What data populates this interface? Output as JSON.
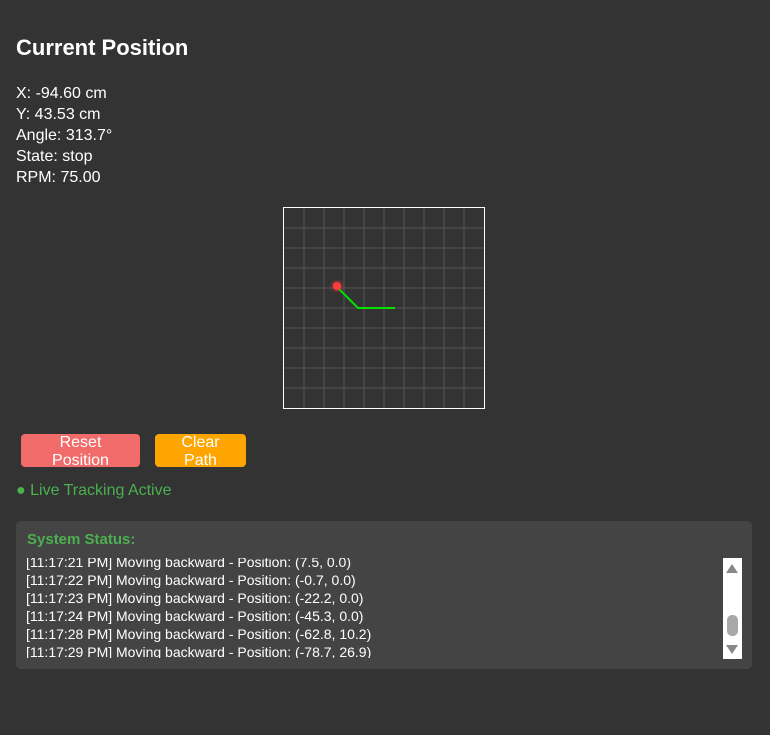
{
  "header": {
    "title": "Current Position"
  },
  "position": {
    "x_text": "X: -94.60 cm",
    "y_text": "Y: 43.53 cm",
    "angle_text": "Angle: 313.7°",
    "state_text": "State: stop",
    "rpm_text": "RPM: 75.00"
  },
  "colors": {
    "path": "#00e000",
    "robot": "#ff3b3b",
    "reset_button": "#f26b6b",
    "clear_button": "#ffa500",
    "status_accent": "#4caf50"
  },
  "controls": {
    "reset_label": "Reset Position",
    "clear_label": "Clear Path"
  },
  "tracking": {
    "status_text": "● Live Tracking Active"
  },
  "system_status": {
    "title": "System Status:",
    "log": [
      "[11:17:21 PM] Moving backward - Position: (7.5, 0.0)",
      "[11:17:22 PM] Moving backward - Position: (-0.7, 0.0)",
      "[11:17:23 PM] Moving backward - Position: (-22.2, 0.0)",
      "[11:17:24 PM] Moving backward - Position: (-45.3, 0.0)",
      "[11:17:28 PM] Moving backward - Position: (-62.8, 10.2)",
      "[11:17:29 PM] Moving backward - Position: (-78.7, 26.9)"
    ]
  }
}
